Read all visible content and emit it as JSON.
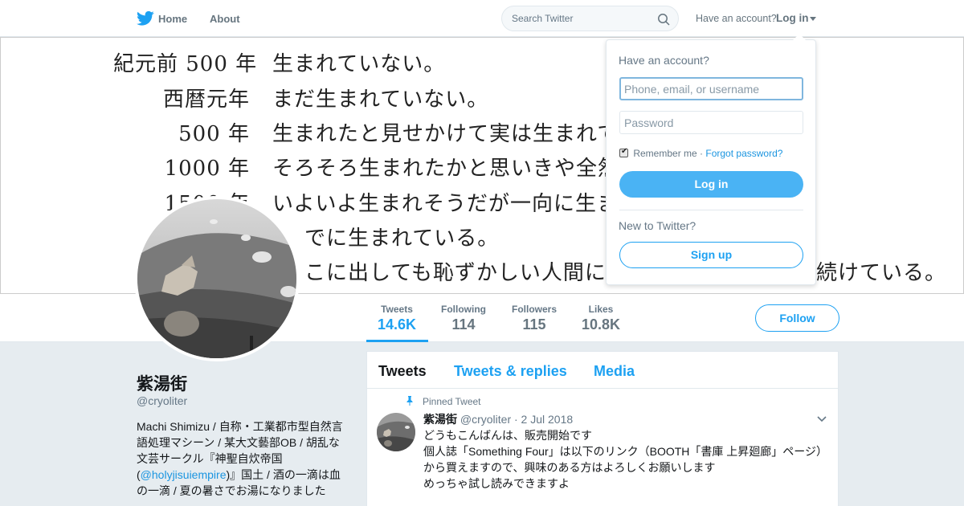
{
  "nav": {
    "home_label": "Home",
    "about_label": "About",
    "search_placeholder": "Search Twitter",
    "have_account_label": "Have an account?",
    "login_label": "Log in"
  },
  "banner": {
    "lines": [
      {
        "year": "紀元前 500 年",
        "text": "生まれていない。"
      },
      {
        "year": "西暦元年",
        "text": "まだ生まれていない。"
      },
      {
        "year": "500 年",
        "text": "生まれたと見せかけて実は生まれて"
      },
      {
        "year": "1000 年",
        "text": "そろそろ生まれたかと思いきや全然"
      },
      {
        "year": "1500 年",
        "text": "いよいよ生まれそうだが一向に生ま"
      },
      {
        "year": "",
        "text": "でに生まれている。"
      },
      {
        "year": "",
        "text": "こに出しても恥ずかしい人間に育"
      },
      {
        "year": "",
        "text": "続けている。"
      }
    ]
  },
  "stats": [
    {
      "label": "Tweets",
      "value": "14.6K"
    },
    {
      "label": "Following",
      "value": "114"
    },
    {
      "label": "Followers",
      "value": "115"
    },
    {
      "label": "Likes",
      "value": "10.8K"
    }
  ],
  "follow_label": "Follow",
  "profile": {
    "name": "紫湯街",
    "handle": "@cryoliter",
    "bio_lines": [
      "Machi Shimizu / 自称・工業都市型自然言",
      "語処理マシーン / 某大文藝部OB / 胡乱な",
      "文芸サークル『神聖自炊帝国",
      "』国土 / 酒の一滴は血",
      "の一滴 / 夏の暑さでお湯になりました"
    ],
    "bio_link": "@holyjisuiempire",
    "bio_paren_open": "(",
    "bio_paren_close": ")"
  },
  "timeline": {
    "tabs": [
      "Tweets",
      "Tweets & replies",
      "Media"
    ],
    "pinned_label": "Pinned Tweet",
    "tweet": {
      "name": "紫湯街",
      "handle": "@cryoliter",
      "date": "· 2 Jul 2018",
      "lines": [
        "どうもこんばんは、販売開始です",
        "個人誌「Something Four」は以下のリンク（BOOTH「書庫 上昇廻廊」ページ）",
        "から買えますので、興味のある方はよろしくお願いします",
        "めっちゃ試し読みできますよ"
      ]
    }
  },
  "login_dropdown": {
    "title": "Have an account?",
    "username_placeholder": "Phone, email, or username",
    "password_placeholder": "Password",
    "remember_label": "Remember me",
    "separator": " · ",
    "forgot_label": "Forgot password?",
    "login_button": "Log in",
    "new_label": "New to Twitter?",
    "signup_button": "Sign up"
  },
  "colors": {
    "accent": "#1da1f2",
    "login_button": "#4ab3f4",
    "background": "#e6ecf0"
  }
}
